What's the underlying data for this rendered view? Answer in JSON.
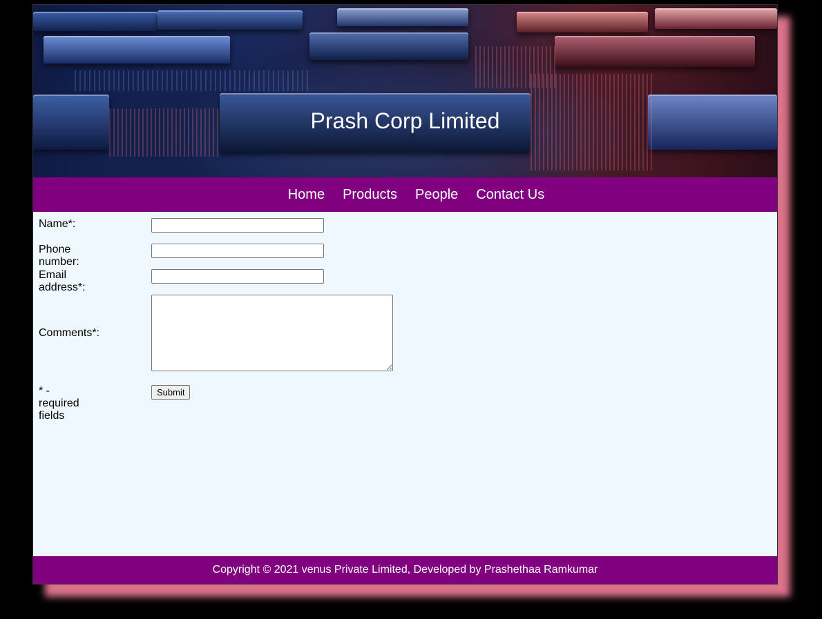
{
  "header": {
    "title": "Prash Corp Limited"
  },
  "nav": {
    "items": [
      {
        "label": "Home"
      },
      {
        "label": "Products"
      },
      {
        "label": "People"
      },
      {
        "label": "Contact Us"
      }
    ]
  },
  "form": {
    "name_label": "Name*:",
    "name_value": "",
    "phone_label": "Phone number:",
    "phone_value": "",
    "email_label": "Email address*:",
    "email_value": "",
    "comments_label": "Comments*:",
    "comments_value": "",
    "required_note": "* - required fields",
    "submit_label": "Submit"
  },
  "footer": {
    "text": "Copyright © 2021 venus Private Limited, Developed by Prashethaa Ramkumar"
  },
  "colors": {
    "nav_bg": "#800080",
    "page_bg": "#f0f8ff",
    "shadow": "#d9728a",
    "outer_bg": "#000000"
  }
}
